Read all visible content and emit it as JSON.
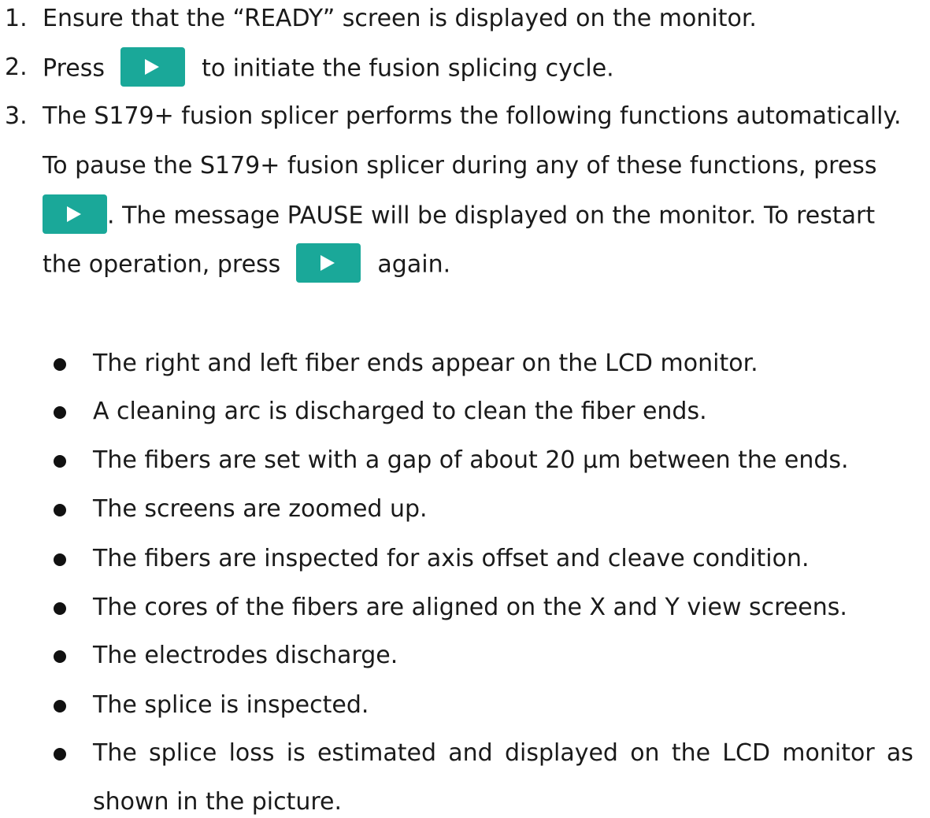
{
  "steps": [
    {
      "number": "1.",
      "text": "Ensure that the “READY” screen is displayed on the monitor."
    },
    {
      "number": "2.",
      "before_button": "Press",
      "after_button": "to initiate the fusion splicing cycle."
    },
    {
      "number": "3.",
      "line1": "The S179+ fusion splicer performs the following functions automatically.",
      "line2": "To pause the S179+ fusion splicer during any of these functions, press",
      "line3_after_button": ". The message PAUSE will be displayed on the monitor. To restart",
      "line4_before_button": "the operation, press",
      "line4_after_button": "again."
    }
  ],
  "button": {
    "icon": "play-icon",
    "color": "#1aa899"
  },
  "bullets": [
    "The right and left fiber ends appear on the LCD monitor.",
    "A cleaning arc is discharged to clean the fiber ends.",
    "The fibers are set with a gap of about 20 μm between the ends.",
    "The screens are zoomed up.",
    "The fibers are inspected for axis offset and cleave condition.",
    "The cores of the fibers are aligned on the X and Y view screens.",
    "The electrodes discharge.",
    "The splice is inspected."
  ],
  "last_bullet": {
    "words": [
      "The",
      "splice",
      "loss",
      "is",
      "estimated",
      "and",
      "displayed",
      "on",
      "the",
      "LCD",
      "monitor",
      "as"
    ],
    "line2": "shown in the picture."
  }
}
